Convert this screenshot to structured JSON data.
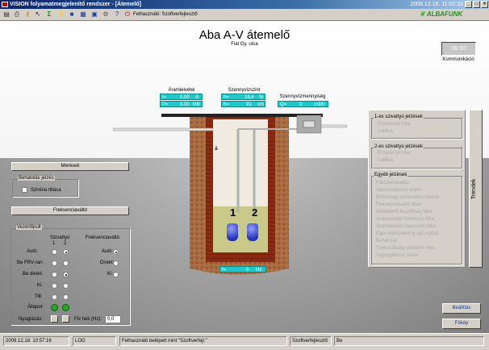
{
  "window": {
    "title": "VISION folyamatmegjelenítő rendszer - [Átemelő]",
    "clock": "2009.12.18. 11:02:33"
  },
  "toolbar": {
    "user_label": "Felhasználó: Szoftverfejlesztő",
    "brand": "ALBAFUNK"
  },
  "station": {
    "title": "Aba A-V átemelő",
    "subtitle": "Fiat Gy. utca",
    "comm_value": "00:00",
    "comm_label": "Kommunikáció"
  },
  "meters": {
    "aramlevetel_label": "Áramlelvétel",
    "current": {
      "key": "I=",
      "value": "0,00",
      "unit": "A"
    },
    "power": {
      "key": "P=",
      "value": "0,00",
      "unit": "kW"
    },
    "szint_label": "Szennyvízszint",
    "level": {
      "key": "h=",
      "value": "16,4",
      "unit": "%"
    },
    "height": {
      "key": "h=",
      "value": "91",
      "unit": "cm"
    },
    "mennyiseg_label": "Szennyvízmennyiség",
    "flow": {
      "key": "Q=",
      "value": "0",
      "unit": "m3/h"
    },
    "freq": {
      "key": "f=",
      "value": "0",
      "unit": "Hz"
    }
  },
  "pumps": {
    "p1": "1",
    "p2": "2"
  },
  "left": {
    "meresek": "Mérések",
    "behatolas_title": "Behatolás jelzés",
    "szirena": "Sziréna tiltása",
    "frekv": "Frekvenciaváltó",
    "vezerles_title": "Vezérlőpult",
    "szivattyu": "Szivattyú",
    "col1": "1",
    "col2": "2",
    "frekv_col": "Frekvenciaváltó",
    "rows": [
      "Autó:",
      "Be FRV-ran:",
      "Be direkt:",
      "Ki:",
      "Tilt:",
      "Állapot:",
      "Nyugtázás:"
    ],
    "frv_rows": [
      "Autó:",
      "Direkt:",
      "Ki:"
    ],
    "fixhek_label": "Fix hek (Hz):",
    "fixhek_value": "0,0"
  },
  "right": {
    "g1_title": "1-es szivattyú jelzések",
    "g1_items": [
      "Érzásorna hiba",
      "Letiltva"
    ],
    "g2_title": "2-es szivattyú jelzések",
    "g2_items": [
      "Érzásorna hiba",
      "Letiltva"
    ],
    "g3_title": "Egyéb jelzések",
    "g3_items": [
      "Fáziskimaradás",
      "Akkumulátoros üzem",
      "Biztonsági automatika üzenet",
      "Frekvenciaváltó hiba",
      "Működtető feszültség hiba",
      "Áramlelvétel minimum hiba",
      "Áramlelvétel maximum hiba",
      "Kapcsolószekrény ajtó nyitva",
      "Behatolás",
      "Túlfeszültség védelem hiba",
      "Aggregátoros üzem"
    ],
    "trends": "Trendek",
    "beallitas": "Beállítás",
    "fokep": "Főkép"
  },
  "status": {
    "date": "2009.12.18. 10:57:16",
    "type": "LOG",
    "msg": "Felhasználó belépett mint \"Szoftverfejl.\"",
    "user": "Szoftverfejlesztő",
    "state": "Be"
  },
  "colors": {
    "meter": "#22c6c6",
    "lamp": "#25a825",
    "brick": "#8c2a12",
    "title_bar": "#0a246a"
  }
}
